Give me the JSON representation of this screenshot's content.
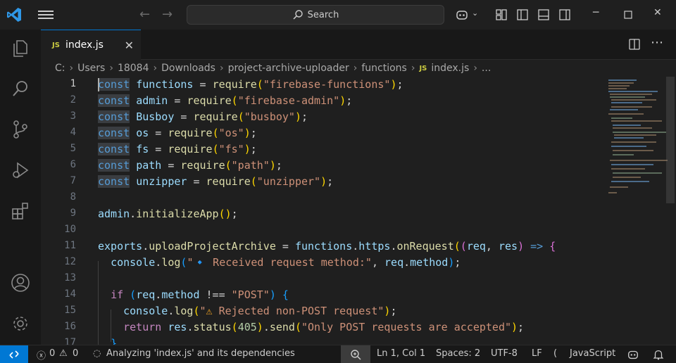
{
  "titlebar": {
    "search_label": "Search"
  },
  "tab": {
    "badge": "JS",
    "label": "index.js",
    "close": "✕"
  },
  "breadcrumb": {
    "items": [
      "C:",
      "Users",
      "18084",
      "Downloads",
      "project-archive-uploader",
      "functions"
    ],
    "file_badge": "JS",
    "file": "index.js",
    "more": "..."
  },
  "editor": {
    "line_numbers": [
      "1",
      "2",
      "3",
      "4",
      "5",
      "6",
      "7",
      "8",
      "9",
      "10",
      "11",
      "12",
      "13",
      "14",
      "15",
      "16",
      "17"
    ],
    "lines": [
      "const functions = require(\"firebase-functions\");",
      "const admin = require(\"firebase-admin\");",
      "const Busboy = require(\"busboy\");",
      "const os = require(\"os\");",
      "const fs = require(\"fs\");",
      "const path = require(\"path\");",
      "const unzipper = require(\"unzipper\");",
      "",
      "admin.initializeApp();",
      "",
      "exports.uploadProjectArchive = functions.https.onRequest((req, res) => {",
      "  console.log(\"🔹 Received request method:\", req.method);",
      "",
      "  if (req.method !== \"POST\") {",
      "    console.log(\"⚠️ Rejected non-POST request\");",
      "    return res.status(405).send(\"Only POST requests are accepted\");",
      "  }"
    ]
  },
  "statusbar": {
    "errors": "0",
    "warnings": "0",
    "analyzing": "Analyzing 'index.js' and its dependencies",
    "position": "Ln 1, Col 1",
    "spaces": "Spaces: 2",
    "encoding": "UTF-8",
    "eol": "LF",
    "language": "JavaScript"
  },
  "colors": {
    "accent": "#0078d4",
    "keyword": "#569cd6",
    "string": "#ce9178",
    "variable": "#9cdcfe",
    "function": "#dcdcaa"
  }
}
